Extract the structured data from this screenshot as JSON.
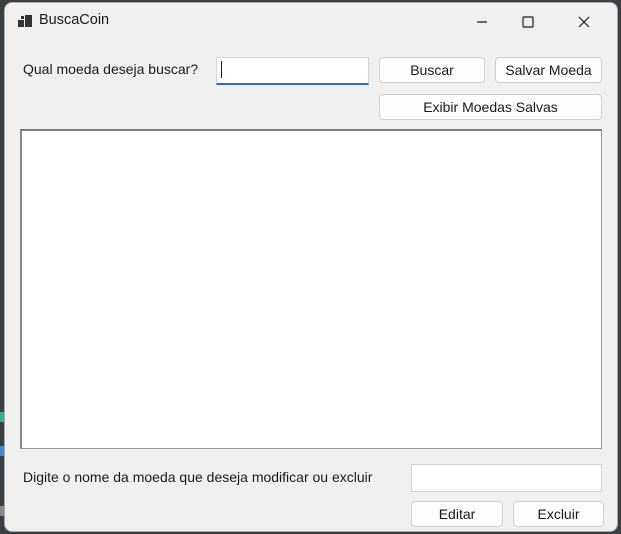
{
  "window": {
    "title": "BuscaCoin"
  },
  "search": {
    "label": "Qual moeda deseja buscar?",
    "value": "",
    "search_button": "Buscar",
    "save_button": "Salvar Moeda",
    "show_saved_button": "Exibir Moedas Salvas"
  },
  "results": {
    "items": []
  },
  "modify": {
    "label": "Digite o nome da moeda que deseja modificar ou excluir",
    "value": "",
    "edit_button": "Editar",
    "delete_button": "Excluir"
  },
  "colors": {
    "window_bg": "#f0f0f0",
    "focus_accent": "#2c6fb3",
    "desktop_bg": "#3b3f44"
  }
}
